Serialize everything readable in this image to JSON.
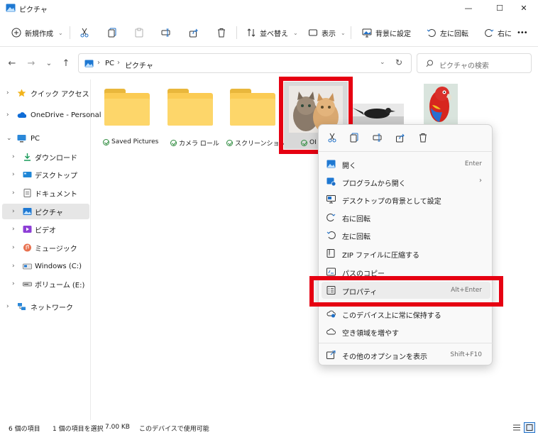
{
  "window": {
    "title": "ピクチャ",
    "controls": {
      "minimize": "—",
      "maximize": "☐",
      "close": "✕"
    }
  },
  "toolbar": {
    "new_label": "新規作成",
    "sort_label": "並べ替え",
    "view_label": "表示",
    "set_background_label": "背景に設定",
    "rotate_left_label": "左に回転",
    "rotate_right_label": "右に",
    "more_label": "•••",
    "chevron": "⌄"
  },
  "nav": {
    "back": "←",
    "forward": "→",
    "recent": "⌄",
    "up": "↑",
    "breadcrumb": [
      "PC",
      "ピクチャ"
    ],
    "crumb_sep": "›",
    "refresh": "↻",
    "search_placeholder": "ピクチャの検索"
  },
  "sidebar": {
    "items": [
      {
        "label": "クイック アクセス",
        "expander": "›",
        "icon": "star-icon"
      },
      {
        "label": "OneDrive - Personal",
        "expander": "›",
        "icon": "cloud-icon"
      },
      {
        "label": "PC",
        "expander": "⌄",
        "icon": "pc-icon"
      },
      {
        "label": "ダウンロード",
        "expander": "›",
        "icon": "download-icon"
      },
      {
        "label": "デスクトップ",
        "expander": "›",
        "icon": "desktop-icon"
      },
      {
        "label": "ドキュメント",
        "expander": "›",
        "icon": "document-icon"
      },
      {
        "label": "ピクチャ",
        "expander": "›",
        "icon": "pictures-icon"
      },
      {
        "label": "ビデオ",
        "expander": "›",
        "icon": "video-icon"
      },
      {
        "label": "ミュージック",
        "expander": "›",
        "icon": "music-icon"
      },
      {
        "label": "Windows (C:)",
        "expander": "›",
        "icon": "drive-icon"
      },
      {
        "label": "ボリューム (E:)",
        "expander": "›",
        "icon": "volume-icon"
      },
      {
        "label": "ネットワーク",
        "expander": "›",
        "icon": "network-icon"
      }
    ]
  },
  "files": [
    {
      "label": "Saved Pictures",
      "type": "folder"
    },
    {
      "label": "カメラ ロール",
      "type": "folder"
    },
    {
      "label": "スクリーンショット",
      "type": "folder"
    },
    {
      "label": "OI",
      "type": "image-cats"
    },
    {
      "type": "image-crow"
    },
    {
      "type": "image-parrot"
    }
  ],
  "context_menu": {
    "items": [
      {
        "label": "開く",
        "shortcut": "Enter",
        "icon": "open-image-icon"
      },
      {
        "label": "プログラムから開く",
        "arrow": "›",
        "icon": "open-with-icon"
      },
      {
        "label": "デスクトップの背景として設定",
        "icon": "wallpaper-icon"
      },
      {
        "label": "右に回転",
        "icon": "rotate-right-icon"
      },
      {
        "label": "左に回転",
        "icon": "rotate-left-icon"
      },
      {
        "label": "ZIP ファイルに圧縮する",
        "icon": "zip-icon"
      },
      {
        "label": "パスのコピー",
        "icon": "copy-path-icon"
      },
      {
        "label": "プロパティ",
        "shortcut": "Alt+Enter",
        "icon": "properties-icon"
      },
      {
        "label": "このデバイス上に常に保持する",
        "icon": "keep-device-icon"
      },
      {
        "label": "空き領域を増やす",
        "icon": "cloud-free-icon"
      },
      {
        "label": "その他のオプションを表示",
        "shortcut": "Shift+F10",
        "icon": "more-options-icon"
      }
    ]
  },
  "status": {
    "item_count": "6 個の項目",
    "selected": "1 個の項目を選択",
    "size": "7.00 KB",
    "availability": "このデバイスで使用可能"
  },
  "colors": {
    "highlight_red": "#e60012",
    "accent_blue": "#0067c0",
    "folder_yellow": "#fbcb53"
  }
}
